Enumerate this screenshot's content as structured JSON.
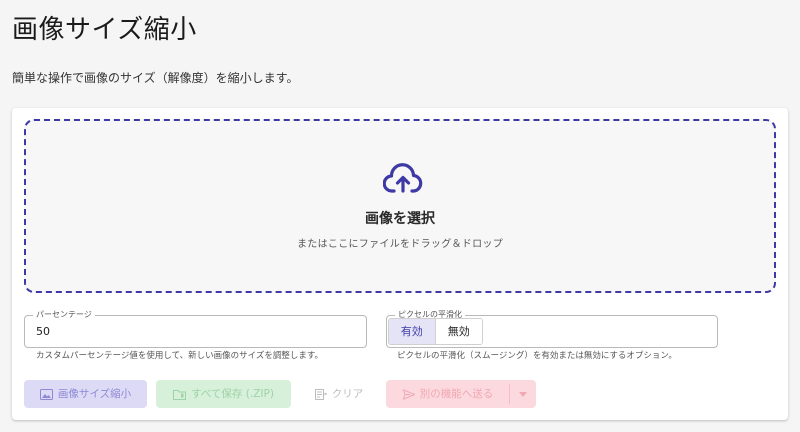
{
  "page": {
    "title": "画像サイズ縮小",
    "description": "簡単な操作で画像のサイズ（解像度）を縮小します。"
  },
  "dropzone": {
    "title": "画像を選択",
    "subtitle": "またはここにファイルをドラッグ＆ドロップ",
    "icon": "cloud-upload-icon",
    "accent_color": "#3d3aa6"
  },
  "percentage": {
    "label": "パーセンテージ",
    "value": "50",
    "helper": "カスタムパーセンテージ値を使用して、新しい画像のサイズを調整します。"
  },
  "smoothing": {
    "label": "ピクセルの平滑化",
    "options": [
      "有効",
      "無効"
    ],
    "selected": "有効",
    "helper": "ピクセルの平滑化（スムージング）を有効または無効にするオプション。"
  },
  "actions": {
    "resize_label": "画像サイズ縮小",
    "save_all_label": "すべて保存 (.ZIP)",
    "clear_label": "クリア",
    "send_label": "別の機能へ送る",
    "colors": {
      "resize": "#dcdaf5",
      "save": "#d6f0d9",
      "send": "#fbd9de"
    }
  }
}
